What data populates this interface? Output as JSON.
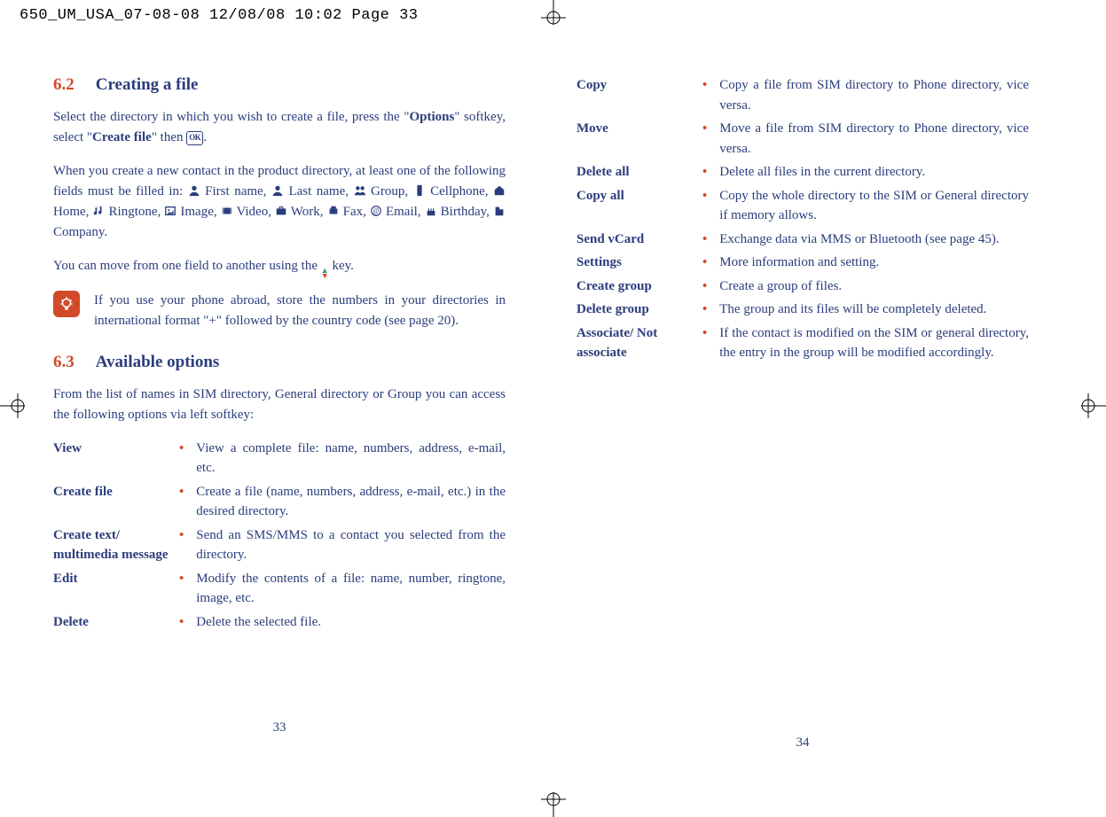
{
  "printHeader": "650_UM_USA_07-08-08  12/08/08  10:02  Page 33",
  "left": {
    "s62_num": "6.2",
    "s62_title": "Creating a file",
    "p1_a": "Select the directory in which you wish to create a file, press the \"",
    "p1_b_bold": "Options",
    "p1_c": "\" softkey, select \"",
    "p1_d_bold": "Create file",
    "p1_e": "\" then ",
    "p1_ok": "OK",
    "p1_f": ".",
    "p2_a": "When you create a new contact in the product directory, at least one of the following fields must be filled in: ",
    "fields_1": " First name, ",
    "fields_2": " Last name, ",
    "fields_3": " Group, ",
    "fields_4": " Cellphone, ",
    "fields_5": " Home, ",
    "fields_6": " Ringtone, ",
    "fields_7": " Image, ",
    "fields_8": " Video, ",
    "fields_9": " Work, ",
    "fields_10": " Fax, ",
    "fields_11": " Email, ",
    "fields_12": " Birthday, ",
    "fields_13": " Company.",
    "p3_a": "You can move from one field to another using the ",
    "p3_b": " key.",
    "tip": "If you use your phone abroad, store the numbers in your directories in international format \"+\" followed by the country code (see page 20).",
    "s63_num": "6.3",
    "s63_title": "Available options",
    "s63_intro": "From the list of names in SIM directory, General directory or Group you can access the following options via left softkey:",
    "options": [
      {
        "term": "View",
        "desc": "View a complete file: name, numbers, address, e-mail, etc."
      },
      {
        "term": "Create file",
        "desc": "Create a file (name, numbers, address, e-mail, etc.) in the desired directory."
      },
      {
        "term": "Create text/ multimedia message",
        "desc": "Send an SMS/MMS to a contact you selected from the directory."
      },
      {
        "term": "Edit",
        "desc": "Modify the contents of a file: name, number, ringtone, image, etc."
      },
      {
        "term": "Delete",
        "desc": "Delete the selected file."
      }
    ],
    "pageNum": "33"
  },
  "right": {
    "options": [
      {
        "term": "Copy",
        "desc": "Copy a file from SIM directory to Phone directory, vice versa."
      },
      {
        "term": "Move",
        "desc": "Move a file from SIM directory to Phone directory, vice versa."
      },
      {
        "term": "Delete all",
        "desc": "Delete all files in the current directory."
      },
      {
        "term": "Copy all",
        "desc": "Copy the whole directory to the SIM or General directory if memory allows."
      },
      {
        "term": "Send vCard",
        "desc": "Exchange data via MMS or Bluetooth (see page 45)."
      },
      {
        "term": "Settings",
        "desc": "More information and setting."
      },
      {
        "term": "Create group",
        "desc": "Create a group of files."
      },
      {
        "term": "Delete group",
        "desc": "The group and its files will be completely deleted."
      },
      {
        "term": "Associate/ Not associate",
        "desc": "If the contact is modified on the SIM or general directory, the entry in the group will be modified accordingly."
      }
    ],
    "pageNum": "34"
  }
}
